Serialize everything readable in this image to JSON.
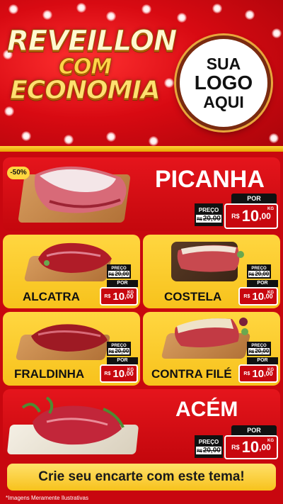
{
  "header": {
    "title_line1": "REVEILLON",
    "title_line2": "COM",
    "title_line3": "ECONOMIA",
    "logo_line1": "SUA",
    "logo_line2": "LOGO",
    "logo_line3": "AQUI"
  },
  "labels": {
    "por": "POR",
    "preco": "PREÇO",
    "currency": "R$",
    "currency_small": "R$",
    "kg": "KG"
  },
  "products": {
    "picanha": {
      "name": "PICANHA",
      "badge": "-50%",
      "old_price": "20,00",
      "new_int": "10",
      "new_dec": ",00"
    },
    "alcatra": {
      "name": "ALCATRA",
      "old_price": "20,00",
      "new_int": "10",
      "new_dec": ",00"
    },
    "costela": {
      "name": "COSTELA",
      "old_price": "20,00",
      "new_int": "10",
      "new_dec": ",00"
    },
    "fraldinha": {
      "name": "FRALDINHA",
      "old_price": "20,00",
      "new_int": "10",
      "new_dec": ",00"
    },
    "contrafile": {
      "name": "CONTRA FILÉ",
      "old_price": "20,00",
      "new_int": "10",
      "new_dec": ",00"
    },
    "acem": {
      "name": "ACÉM",
      "old_price": "20,00",
      "new_int": "10",
      "new_dec": ",00"
    }
  },
  "footer": {
    "cta": "Crie seu encarte com este tema!",
    "disclaimer": "*Imagens Meramente Ilustrativas"
  },
  "colors": {
    "brand_red": "#c8070f",
    "brand_yellow": "#f7c21c"
  }
}
